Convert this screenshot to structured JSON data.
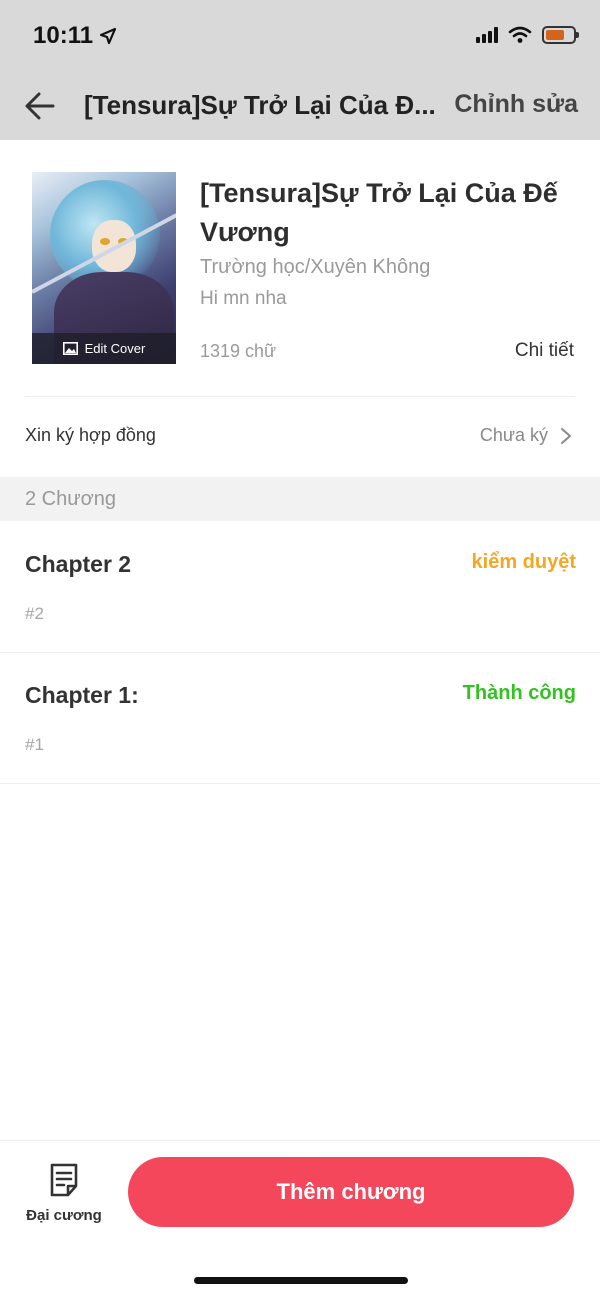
{
  "status_bar": {
    "time": "10:11"
  },
  "nav": {
    "title": "[Tensura]Sự Trở Lại Của Đ...",
    "edit_label": "Chỉnh sửa"
  },
  "book": {
    "title": "[Tensura]Sự Trở Lại Của Đế Vương",
    "genre": "Trường học/Xuyên Không",
    "description": "Hi mn nha",
    "word_count": "1319 chữ",
    "detail_label": "Chi tiết",
    "cover_button_label": "Edit Cover"
  },
  "contract": {
    "label": "Xin ký hợp đồng",
    "status": "Chưa ký"
  },
  "chapters_section": {
    "count_label": "2 Chương",
    "items": [
      {
        "title": "Chapter 2",
        "number": "#2",
        "status": "kiểm duyệt",
        "status_color": "#f5a623"
      },
      {
        "title": "Chapter 1:",
        "number": "#1",
        "status": "Thành công",
        "status_color": "#33c21f"
      }
    ]
  },
  "bottom_bar": {
    "outline_label": "Đại cương",
    "add_chapter_label": "Thêm chương",
    "accent": "#f4475b"
  },
  "icons": [
    "location-arrow-icon",
    "signal-icon",
    "wifi-icon",
    "battery-icon",
    "back-arrow-icon",
    "image-icon",
    "chevron-right-icon",
    "outline-document-icon"
  ]
}
